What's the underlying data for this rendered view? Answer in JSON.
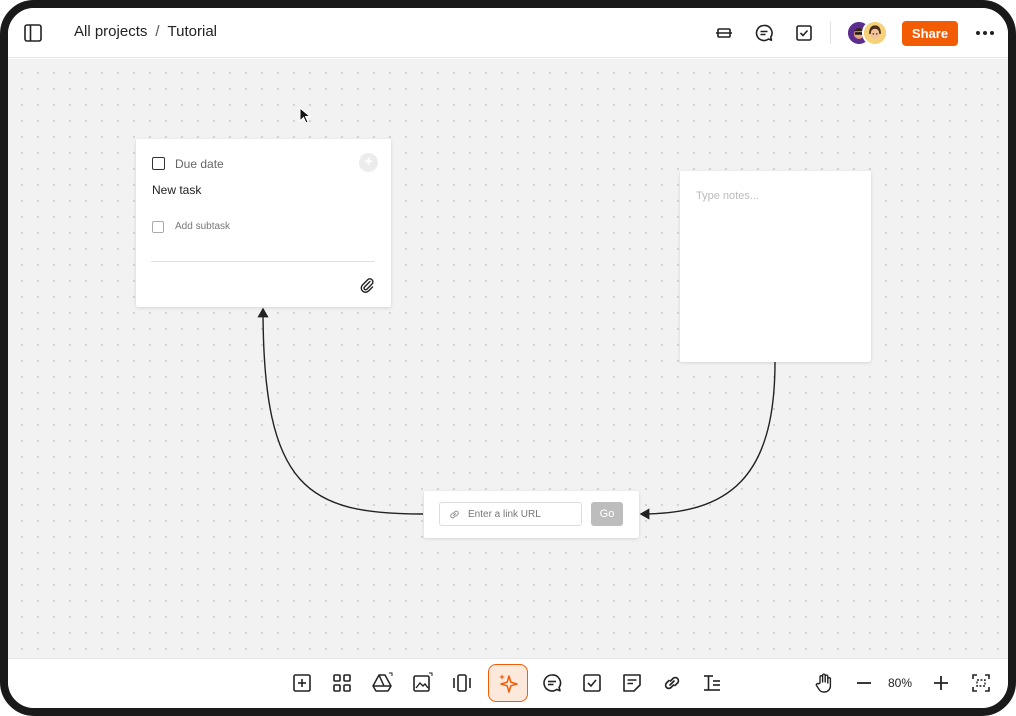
{
  "breadcrumb": {
    "root": "All projects",
    "separator": "/",
    "current": "Tutorial"
  },
  "topbar": {
    "icons": [
      "sidebar-toggle-icon",
      "card-view-icon",
      "comment-icon",
      "task-check-icon"
    ],
    "share_label": "Share",
    "more_icon": "more-horizontal-icon"
  },
  "task_card": {
    "due_date_label": "Due date",
    "title": "New task",
    "subtask_label": "Add subtask"
  },
  "note_card": {
    "placeholder": "Type notes..."
  },
  "link_card": {
    "placeholder": "Enter a link URL",
    "go_label": "Go"
  },
  "bottombar": {
    "tools": [
      "add-board-icon",
      "grid-icon",
      "drive-icon",
      "image-icon",
      "carousel-icon",
      "ai-sparkle-icon",
      "comment-icon",
      "task-check-icon",
      "note-icon",
      "link-icon",
      "text-format-icon"
    ],
    "zoom_level": "80%"
  },
  "colors": {
    "accent": "#f25c05",
    "canvas_bg": "#f2f2f2"
  }
}
